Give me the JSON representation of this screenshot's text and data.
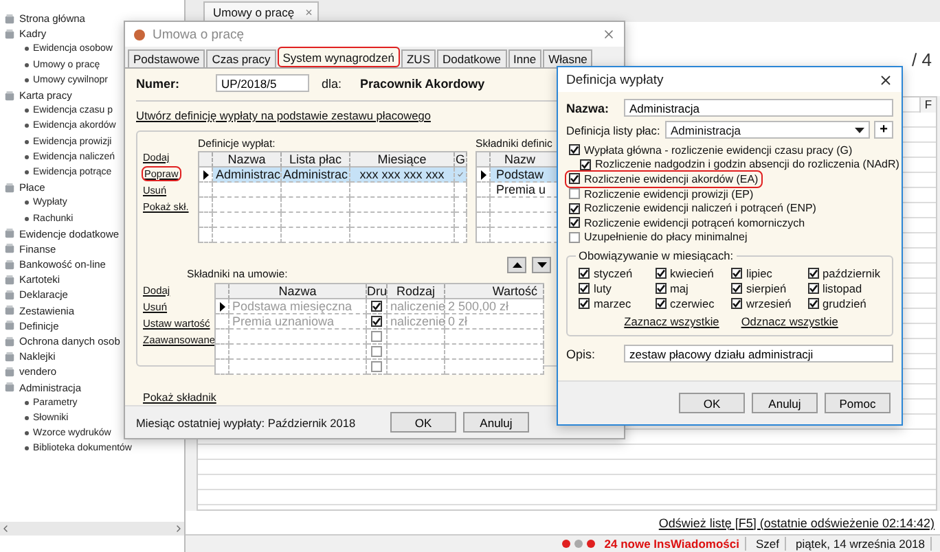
{
  "sidebar": {
    "items": [
      {
        "label": "Strona główna"
      },
      {
        "label": "Kadry",
        "children": [
          {
            "label": "Ewidencja osobow"
          },
          {
            "label": "Umowy o pracę"
          },
          {
            "label": "Umowy cywilnopr"
          }
        ]
      },
      {
        "label": "Karta pracy",
        "children": [
          {
            "label": "Ewidencja czasu p"
          },
          {
            "label": "Ewidencja akordów"
          },
          {
            "label": "Ewidencja prowizji"
          },
          {
            "label": "Ewidencja naliczeń"
          },
          {
            "label": "Ewidencja potrące"
          }
        ]
      },
      {
        "label": "Płace",
        "children": [
          {
            "label": "Wypłaty"
          },
          {
            "label": "Rachunki"
          }
        ]
      },
      {
        "label": "Ewidencje dodatkowe"
      },
      {
        "label": "Finanse"
      },
      {
        "label": "Bankowość on-line"
      },
      {
        "label": "Kartoteki"
      },
      {
        "label": "Deklaracje"
      },
      {
        "label": "Zestawienia"
      },
      {
        "label": "Definicje"
      },
      {
        "label": "Ochrona danych osob"
      },
      {
        "label": "Naklejki"
      },
      {
        "label": "vendero"
      },
      {
        "label": "Administracja",
        "children": [
          {
            "label": "Parametry"
          },
          {
            "label": "Słowniki"
          },
          {
            "label": "Wzorce wydruków"
          },
          {
            "label": "Biblioteka dokumentów"
          }
        ]
      }
    ]
  },
  "document_tab": {
    "label": "Umowy o pracę",
    "close": "×"
  },
  "list_view": {
    "page_count": "/ 4",
    "column_header": "F",
    "refresh_link": "Odśwież listę [F5] (ostatnie odświeżenie 02:14:42)"
  },
  "status_bar": {
    "messages": "24 nowe InsWiadomości",
    "user": "Szef",
    "date": "piątek, 14 września 2018"
  },
  "contract_dialog": {
    "title": "Umowa o pracę",
    "tabs": [
      {
        "label": "Podstawowe",
        "selected": false,
        "highlighted": false
      },
      {
        "label": "Czas pracy",
        "selected": false,
        "highlighted": false
      },
      {
        "label": "System wynagrodzeń",
        "selected": true,
        "highlighted": true
      },
      {
        "label": "ZUS",
        "selected": false,
        "highlighted": false
      },
      {
        "label": "Dodatkowe",
        "selected": false,
        "highlighted": false
      },
      {
        "label": "Inne",
        "selected": false,
        "highlighted": false
      },
      {
        "label": "Własne",
        "selected": false,
        "highlighted": false
      }
    ],
    "number_label": "Numer:",
    "number": "UP/2018/5",
    "for_label": "dla:",
    "employee": "Pracownik Akordowy",
    "create_link": "Utwórz definicję wypłaty na podstawie zestawu płacowego",
    "definitions": {
      "label": "Definicje wypłat:",
      "actions": [
        {
          "label": "Dodaj",
          "highlighted": false
        },
        {
          "label": "Popraw",
          "highlighted": true
        },
        {
          "label": "Usuń",
          "highlighted": false
        },
        {
          "label": "Pokaż skł.",
          "highlighted": false
        }
      ],
      "columns": [
        "Nazwa",
        "Lista płac",
        "Miesiące",
        "G"
      ],
      "rows": [
        {
          "cells": [
            "Administrac",
            "Administrac",
            "xxx xxx xxx xxx"
          ],
          "checked": true,
          "selected": true
        }
      ]
    },
    "definition_components": {
      "label": "Składniki definic",
      "columns": [
        "Nazw"
      ],
      "rows": [
        {
          "name": "Podstaw",
          "selected": true
        },
        {
          "name": "Premia u",
          "selected": false
        }
      ]
    },
    "contract_components": {
      "label": "Składniki na umowie:",
      "actions": [
        "Dodaj",
        "Usuń",
        "Ustaw wartość",
        "Zaawansowane"
      ],
      "columns": [
        "Nazwa",
        "Dru",
        "Rodzaj",
        "Wartość"
      ],
      "rows": [
        {
          "name": "Podstawa miesięczna",
          "printed": true,
          "type": "naliczenie",
          "value": "2 500,00 zł",
          "selected": true
        },
        {
          "name": "Premia uznaniowa",
          "printed": true,
          "type": "naliczenie",
          "value": "0 zł",
          "selected": false
        },
        {
          "printed": false,
          "selected": false
        },
        {
          "printed": false,
          "selected": false
        },
        {
          "printed": false,
          "selected": false
        }
      ],
      "show_link": "Pokaż składnik"
    },
    "last_payout": "Miesiąc ostatniej wypłaty: Październik 2018",
    "buttons": [
      "OK",
      "Anuluj"
    ]
  },
  "payout_dialog": {
    "title": "Definicja wypłaty",
    "name_label": "Nazwa:",
    "name": "Administracja",
    "list_label": "Definicja listy płac:",
    "list_value": "Administracja",
    "add": "+",
    "options": [
      {
        "label": "Wypłata główna - rozliczenie ewidencji czasu pracy (G)",
        "checked": true,
        "highlighted": false,
        "children": [
          {
            "label": "Rozliczenie nadgodzin i godzin absencji do rozliczenia (NAdR)",
            "checked": true,
            "highlighted": false
          }
        ]
      },
      {
        "label": "Rozliczenie ewidencji akordów (EA)",
        "checked": true,
        "highlighted": true
      },
      {
        "label": "Rozliczenie ewidencji prowizji (EP)",
        "checked": false,
        "highlighted": false
      },
      {
        "label": "Rozliczenie ewidencji naliczeń i potrąceń (ENP)",
        "checked": true,
        "highlighted": false
      },
      {
        "label": "Rozliczenie ewidencji potrąceń komorniczych",
        "checked": true,
        "highlighted": false
      },
      {
        "label": "Uzupełnienie do płacy minimalnej",
        "checked": false,
        "highlighted": false
      }
    ],
    "months_group": {
      "legend": "Obowiązywanie w miesiącach:",
      "months": [
        {
          "label": "styczeń",
          "checked": true
        },
        {
          "label": "luty",
          "checked": true
        },
        {
          "label": "marzec",
          "checked": true
        },
        {
          "label": "kwiecień",
          "checked": true
        },
        {
          "label": "maj",
          "checked": true
        },
        {
          "label": "czerwiec",
          "checked": true
        },
        {
          "label": "lipiec",
          "checked": true
        },
        {
          "label": "sierpień",
          "checked": true
        },
        {
          "label": "wrzesień",
          "checked": true
        },
        {
          "label": "październik",
          "checked": true
        },
        {
          "label": "listopad",
          "checked": true
        },
        {
          "label": "grudzień",
          "checked": true
        }
      ],
      "select_all": "Zaznacz wszystkie",
      "deselect_all": "Odznacz wszystkie"
    },
    "description_label": "Opis:",
    "description": "zestaw płacowy działu administracji",
    "buttons": [
      "OK",
      "Anuluj",
      "Pomoc"
    ]
  }
}
